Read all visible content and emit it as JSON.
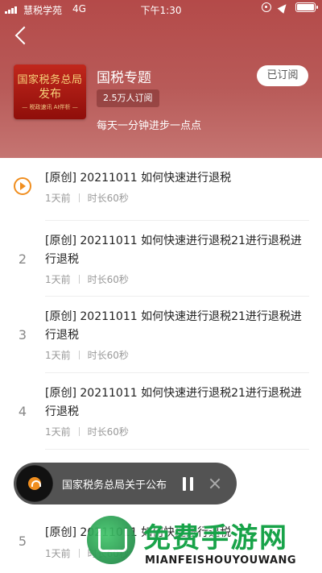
{
  "status_bar": {
    "carrier": "慧税学苑",
    "network": "4G",
    "time": "下午1:30"
  },
  "header": {
    "cover_lines": [
      "国家税务总局",
      "发布",
      "— 税政速讯  AI伴析 —"
    ],
    "title": "国税专题",
    "subscribers": "2.5万人订阅",
    "subscribe_button": "已订阅",
    "description": "每天一分钟进步一点点"
  },
  "episodes": [
    {
      "index": "",
      "playing": true,
      "title": "[原创] 20211011 如何快速进行退税",
      "age": "1天前",
      "duration": "时长60秒"
    },
    {
      "index": "2",
      "playing": false,
      "title": "[原创] 20211011 如何快速进行退税21进行退税进行退税",
      "age": "1天前",
      "duration": "时长60秒"
    },
    {
      "index": "3",
      "playing": false,
      "title": "[原创] 20211011 如何快速进行退税21进行退税进行退税",
      "age": "1天前",
      "duration": "时长60秒"
    },
    {
      "index": "4",
      "playing": false,
      "title": "[原创] 20211011 如何快速进行退税21进行退税进行退税",
      "age": "1天前",
      "duration": "时长60秒"
    },
    {
      "index": "5",
      "playing": false,
      "title": "[原创] 20211011 如何快速进行退税",
      "age": "1天前",
      "duration": "时长60秒"
    }
  ],
  "player": {
    "title": "国家税务总局关于公布"
  },
  "watermark": {
    "main": "免费手游网",
    "sub": "MIANFEISHOUYOUWANG"
  },
  "colors": {
    "header_bg": "#b44a49",
    "accent": "#f08e1f",
    "watermark": "#18a349"
  }
}
